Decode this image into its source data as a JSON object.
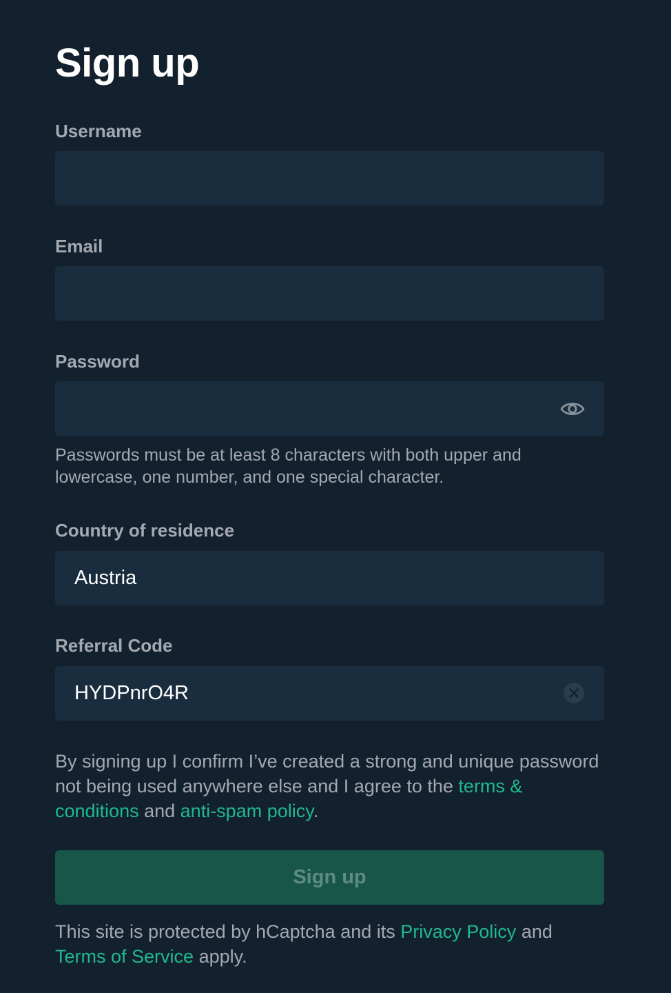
{
  "page_title": "Sign up",
  "fields": {
    "username": {
      "label": "Username",
      "value": "",
      "placeholder": ""
    },
    "email": {
      "label": "Email",
      "value": "",
      "placeholder": ""
    },
    "password": {
      "label": "Password",
      "value": "",
      "placeholder": "",
      "toggle_icon": "eye-icon",
      "hint": "Passwords must be at least 8 characters with both upper and lowercase, one number, and one special character."
    },
    "country": {
      "label": "Country of residence",
      "value": "Austria"
    },
    "referral": {
      "label": "Referral Code",
      "value": "HYDPnrO4R",
      "clear_icon": "clear-icon"
    }
  },
  "consent": {
    "text_1": "By signing up I confirm I’ve created a strong and unique password not being used anywhere else and I agree to the ",
    "terms_link": "terms & conditions",
    "text_2": " and ",
    "antispam_link": "anti-spam policy",
    "text_3": "."
  },
  "submit_label": "Sign up",
  "footer": {
    "text_1": "This site is protected by hCaptcha and its ",
    "privacy_link": "Privacy Policy",
    "text_2": " and ",
    "tos_link": "Terms of Service",
    "text_3": " apply."
  },
  "colors": {
    "background": "#13202d",
    "field_background": "#1a2d3e",
    "accent": "#1fb98e",
    "button_background": "#175649",
    "label": "#a3a9b1"
  }
}
